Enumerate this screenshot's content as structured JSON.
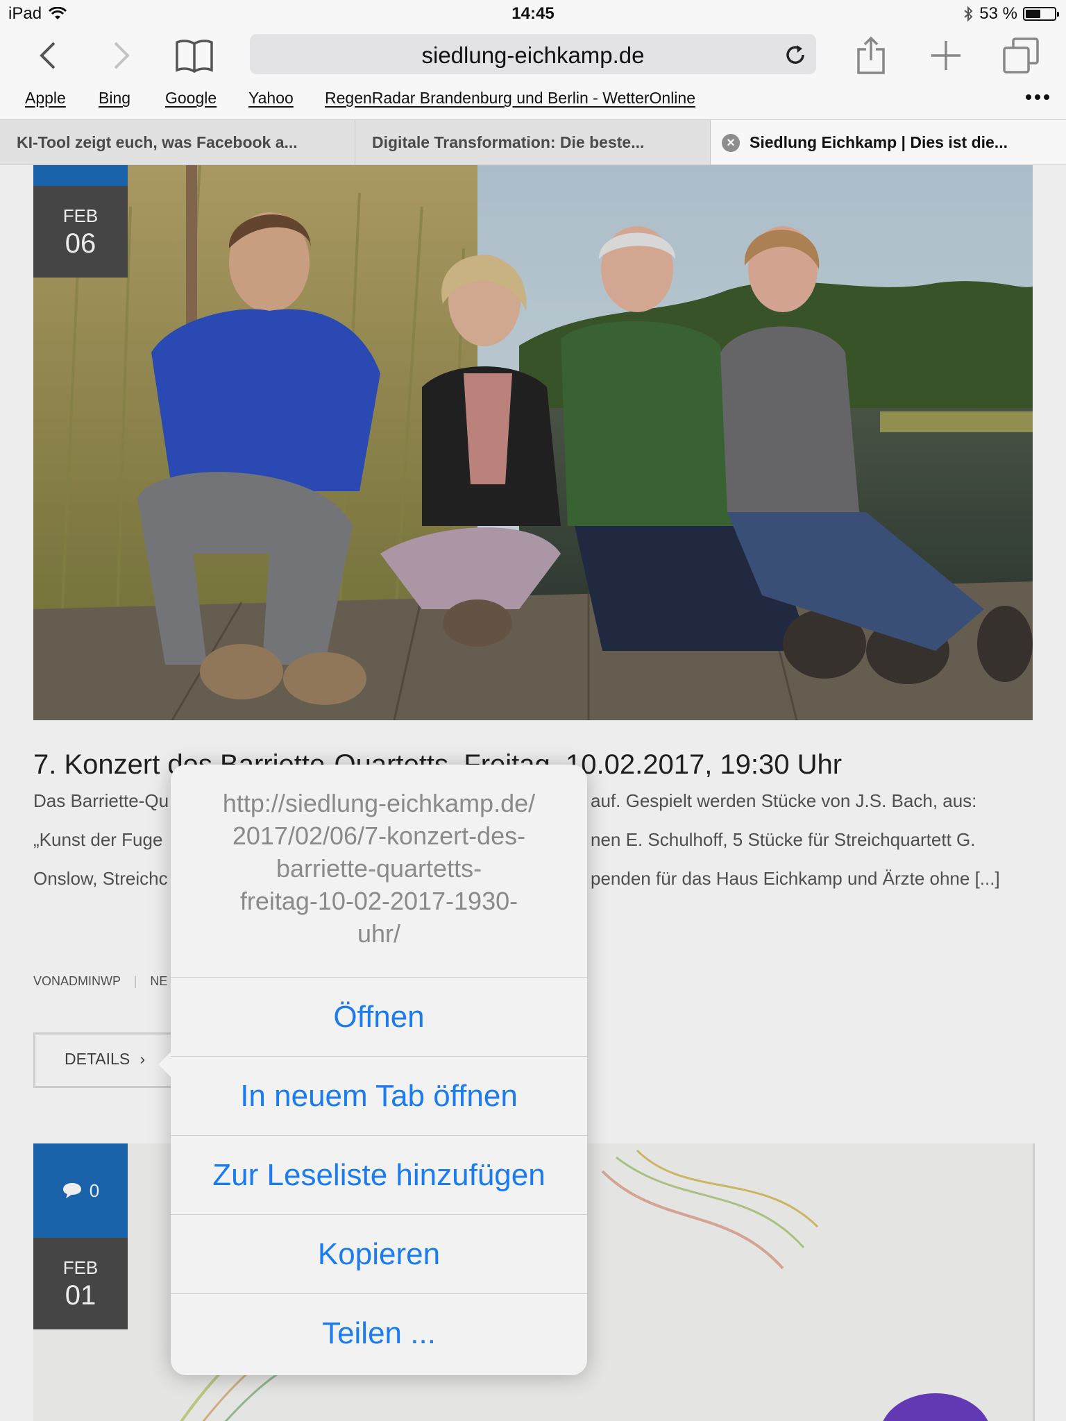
{
  "status_bar": {
    "device": "iPad",
    "time": "14:45",
    "battery": "53 %",
    "battery_level": 0.53
  },
  "toolbar": {
    "url": "siedlung-eichkamp.de"
  },
  "bookmarks": [
    "Apple",
    "Bing",
    "Google",
    "Yahoo",
    "RegenRadar Brandenburg und Berlin - WetterOnline"
  ],
  "tabs": [
    {
      "title": "KI-Tool zeigt euch, was Facebook a..."
    },
    {
      "title": "Digitale Transformation: Die beste..."
    },
    {
      "title": "Siedlung Eichkamp | Dies ist die..."
    }
  ],
  "post1": {
    "month": "FEB",
    "day": "06",
    "title": "7. Konzert des Barriette-Quartetts, Freitag, 10.02.2017, 19:30 Uhr",
    "excerpt_left": [
      "Das Barriette-Qu",
      "„Kunst der Fuge",
      "Onslow, Streichc"
    ],
    "excerpt_right": [
      "auf. Gespielt werden Stücke von J.S. Bach, aus:",
      "nen E. Schulhoff, 5 Stücke für Streichquartett G.",
      "penden für das Haus Eichkamp und Ärzte ohne [...]"
    ],
    "author": "VONADMINWP",
    "category": "NE",
    "details_label": "DETAILS"
  },
  "post2": {
    "comments": "0",
    "month": "FEB",
    "day": "01"
  },
  "popover": {
    "url_lines": [
      "http://siedlung-eichkamp.de/",
      "2017/02/06/7-konzert-des-",
      "barriette-quartetts-",
      "freitag-10-02-2017-1930-",
      "uhr/"
    ],
    "items": [
      "Öffnen",
      "In neuem Tab öffnen",
      "Zur Leseliste hinzufügen",
      "Kopieren",
      "Teilen ..."
    ]
  }
}
